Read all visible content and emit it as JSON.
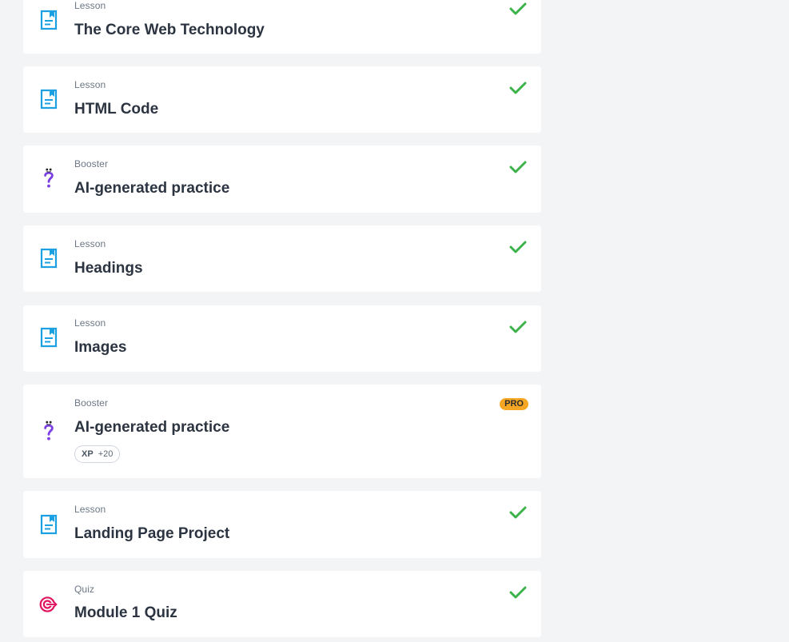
{
  "items": [
    {
      "type": "Lesson",
      "title": "The Core Web Technology",
      "kind": "lesson-icon",
      "status": "completed"
    },
    {
      "type": "Lesson",
      "title": "HTML Code",
      "kind": "lesson-icon",
      "status": "completed"
    },
    {
      "type": "Booster",
      "title": "AI-generated practice",
      "kind": "booster-icon",
      "status": "completed"
    },
    {
      "type": "Lesson",
      "title": "Headings",
      "kind": "lesson-icon",
      "status": "completed"
    },
    {
      "type": "Lesson",
      "title": "Images",
      "kind": "lesson-icon",
      "status": "completed"
    },
    {
      "type": "Booster",
      "title": "AI-generated practice",
      "kind": "booster-icon",
      "status": "pro",
      "badge": "PRO",
      "xp_label": "XP",
      "xp_value": "+20"
    },
    {
      "type": "Lesson",
      "title": "Landing Page Project",
      "kind": "lesson-icon",
      "status": "completed"
    },
    {
      "type": "Quiz",
      "title": "Module 1 Quiz",
      "kind": "quiz-icon",
      "status": "completed"
    }
  ],
  "colors": {
    "lesson_icon": "#1ba1e2",
    "booster_icon": "#7b3fe4",
    "quiz_icon": "#e0155f",
    "check": "#3cb34a",
    "pro_badge": "#f5a623"
  }
}
